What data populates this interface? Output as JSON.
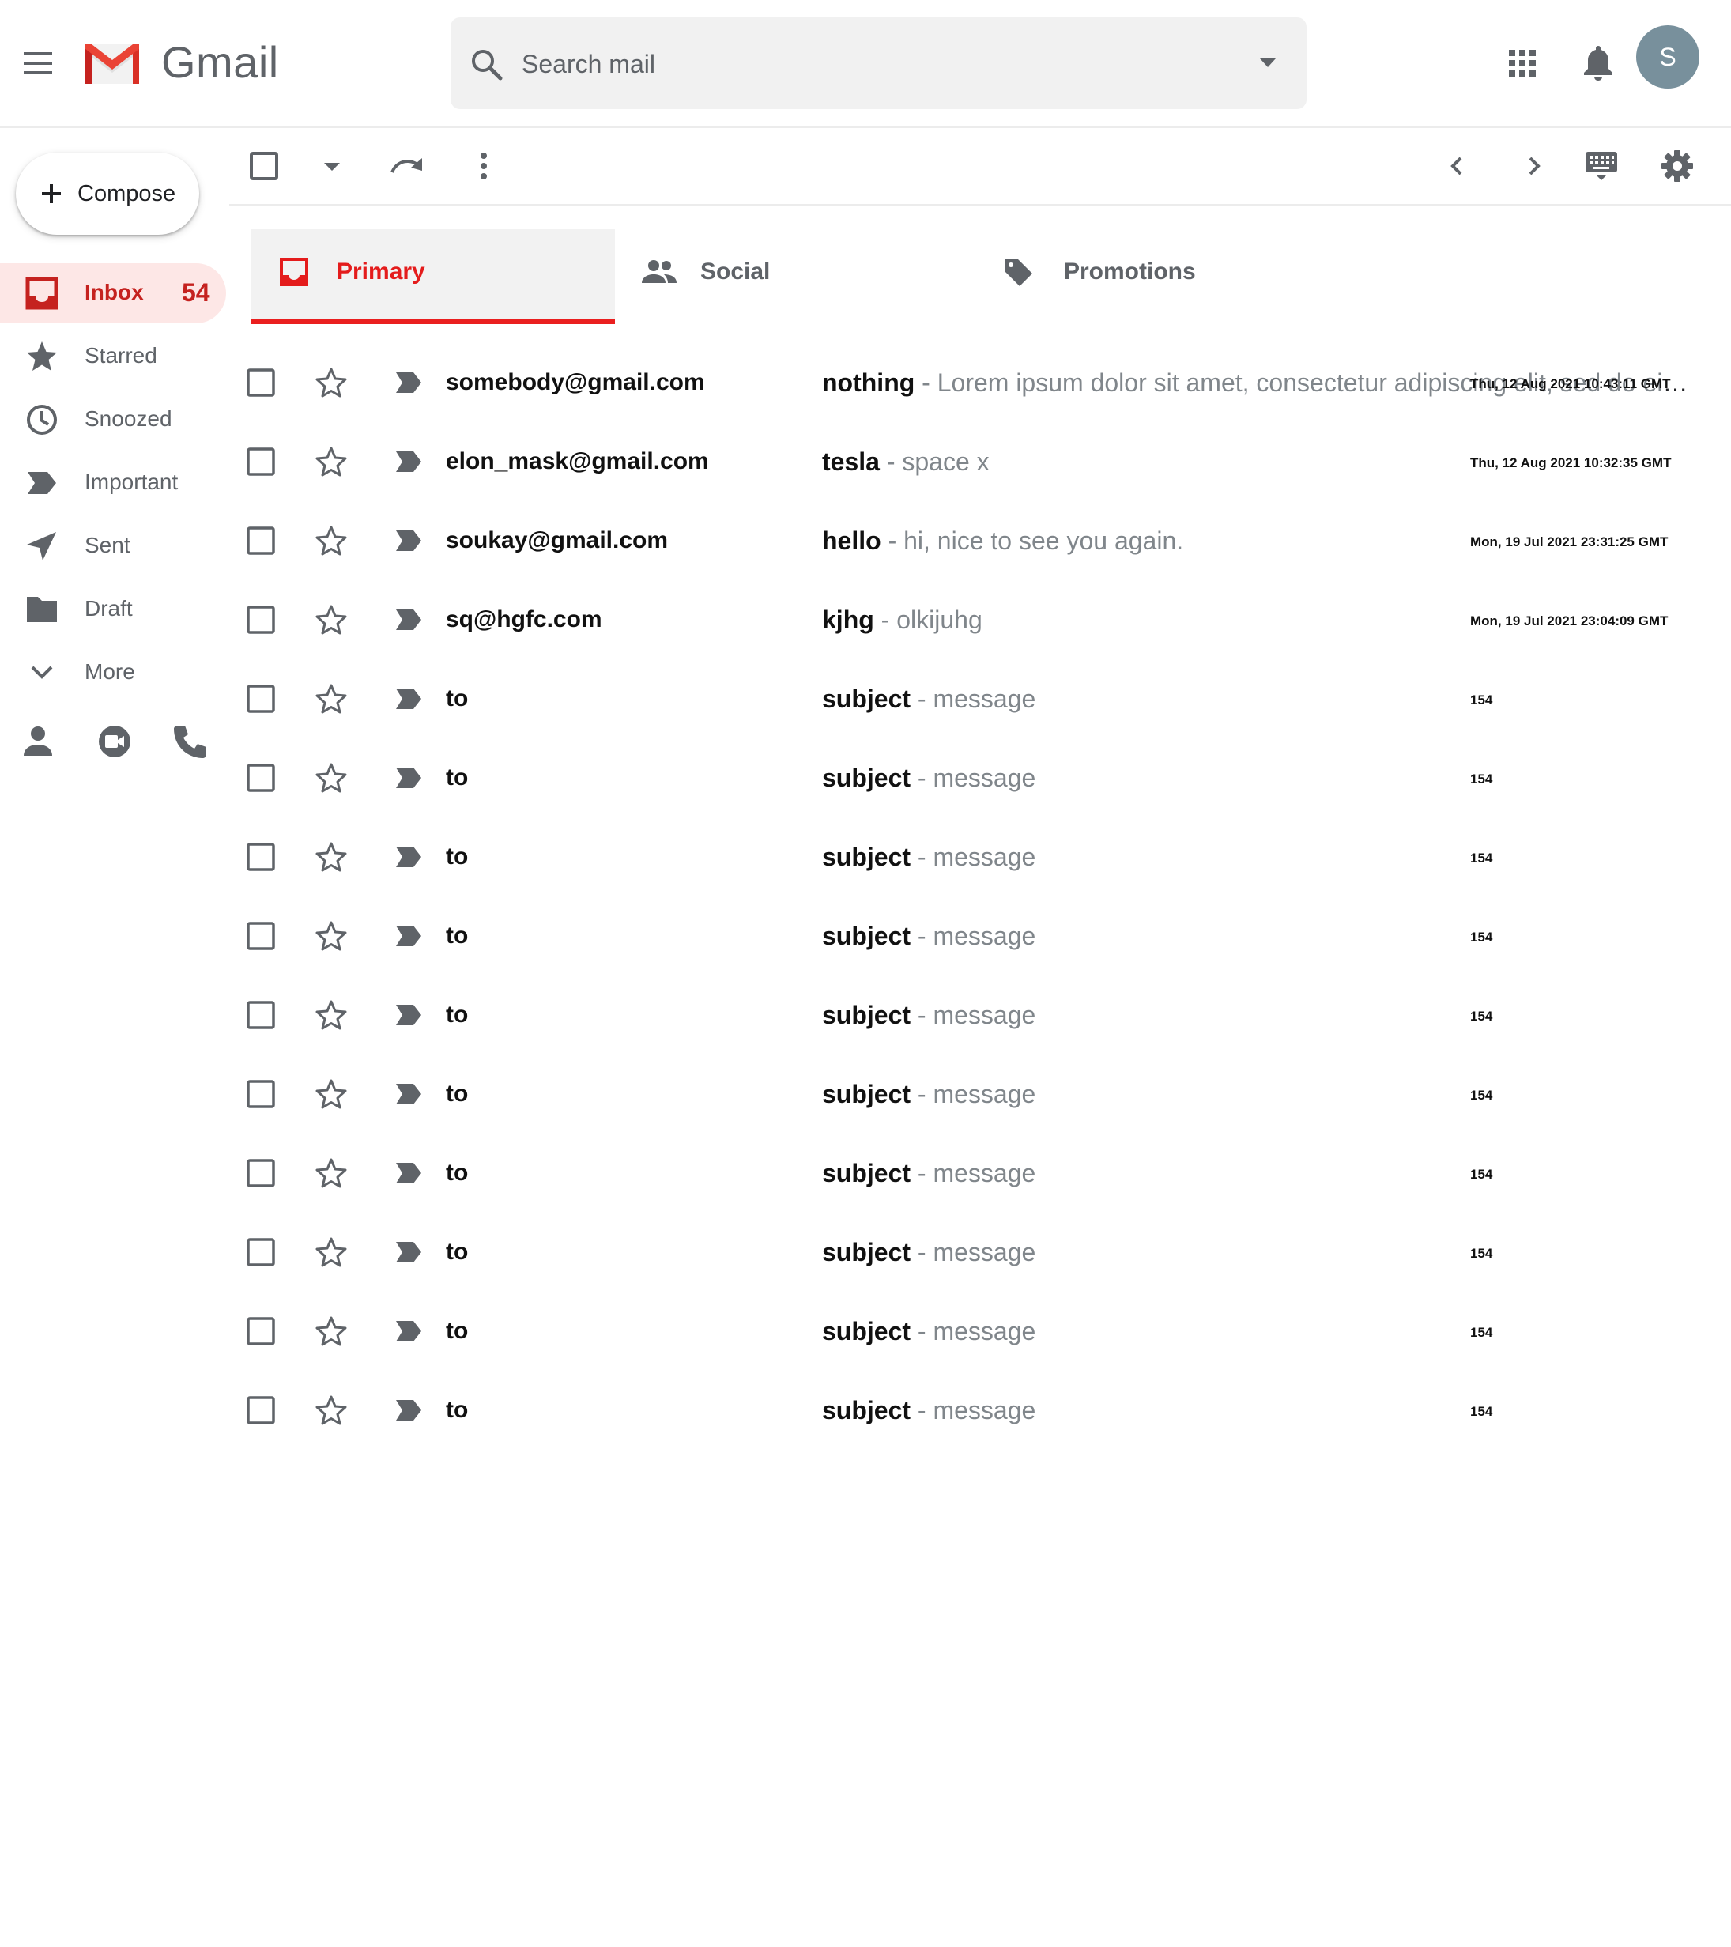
{
  "header": {
    "app_name": "Gmail",
    "search_placeholder": "Search mail",
    "avatar_initial": "S"
  },
  "sidebar": {
    "compose_label": "Compose",
    "items": [
      {
        "label": "Inbox",
        "count": "54",
        "icon": "inbox-icon",
        "active": true
      },
      {
        "label": "Starred",
        "icon": "star-icon"
      },
      {
        "label": "Snoozed",
        "icon": "clock-icon"
      },
      {
        "label": "Important",
        "icon": "important-icon"
      },
      {
        "label": "Sent",
        "icon": "send-icon"
      },
      {
        "label": "Draft",
        "icon": "draft-icon"
      },
      {
        "label": "More",
        "icon": "chevron-down-icon"
      }
    ],
    "bottom_icons": [
      "person-icon",
      "meet-icon",
      "phone-icon"
    ]
  },
  "tabs": [
    {
      "label": "Primary",
      "icon": "inbox-icon",
      "active": true
    },
    {
      "label": "Social",
      "icon": "people-icon"
    },
    {
      "label": "Promotions",
      "icon": "tag-icon"
    }
  ],
  "mails": [
    {
      "sender": "somebody@gmail.com",
      "subject": "nothing",
      "snippet": "Lorem ipsum dolor sit amet, consectetur adipiscing elit, sed do eiusmod tempor incididunt",
      "date": "Thu, 12 Aug 2021 10:43:11 GMT"
    },
    {
      "sender": "elon_mask@gmail.com",
      "subject": "tesla",
      "snippet": "space x",
      "date": "Thu, 12 Aug 2021 10:32:35 GMT"
    },
    {
      "sender": "soukay@gmail.com",
      "subject": "hello",
      "snippet": "hi, nice to see you again.",
      "date": "Mon, 19 Jul 2021 23:31:25 GMT"
    },
    {
      "sender": "sq@hgfc.com",
      "subject": "kjhg",
      "snippet": "olkijuhg",
      "date": "Mon, 19 Jul 2021 23:04:09 GMT"
    },
    {
      "sender": "to",
      "subject": "subject",
      "snippet": "message",
      "date": "154"
    },
    {
      "sender": "to",
      "subject": "subject",
      "snippet": "message",
      "date": "154"
    },
    {
      "sender": "to",
      "subject": "subject",
      "snippet": "message",
      "date": "154"
    },
    {
      "sender": "to",
      "subject": "subject",
      "snippet": "message",
      "date": "154"
    },
    {
      "sender": "to",
      "subject": "subject",
      "snippet": "message",
      "date": "154"
    },
    {
      "sender": "to",
      "subject": "subject",
      "snippet": "message",
      "date": "154"
    },
    {
      "sender": "to",
      "subject": "subject",
      "snippet": "message",
      "date": "154"
    },
    {
      "sender": "to",
      "subject": "subject",
      "snippet": "message",
      "date": "154"
    },
    {
      "sender": "to",
      "subject": "subject",
      "snippet": "message",
      "date": "154"
    },
    {
      "sender": "to",
      "subject": "subject",
      "snippet": "message",
      "date": "154"
    }
  ],
  "snippet_separator": "-",
  "colors": {
    "accent": "#ea1f1f",
    "inbox_active_bg": "#fde7e6",
    "inbox_active_text": "#c5221f",
    "icon_grey": "#5f6368",
    "avatar_bg": "#78909c"
  }
}
